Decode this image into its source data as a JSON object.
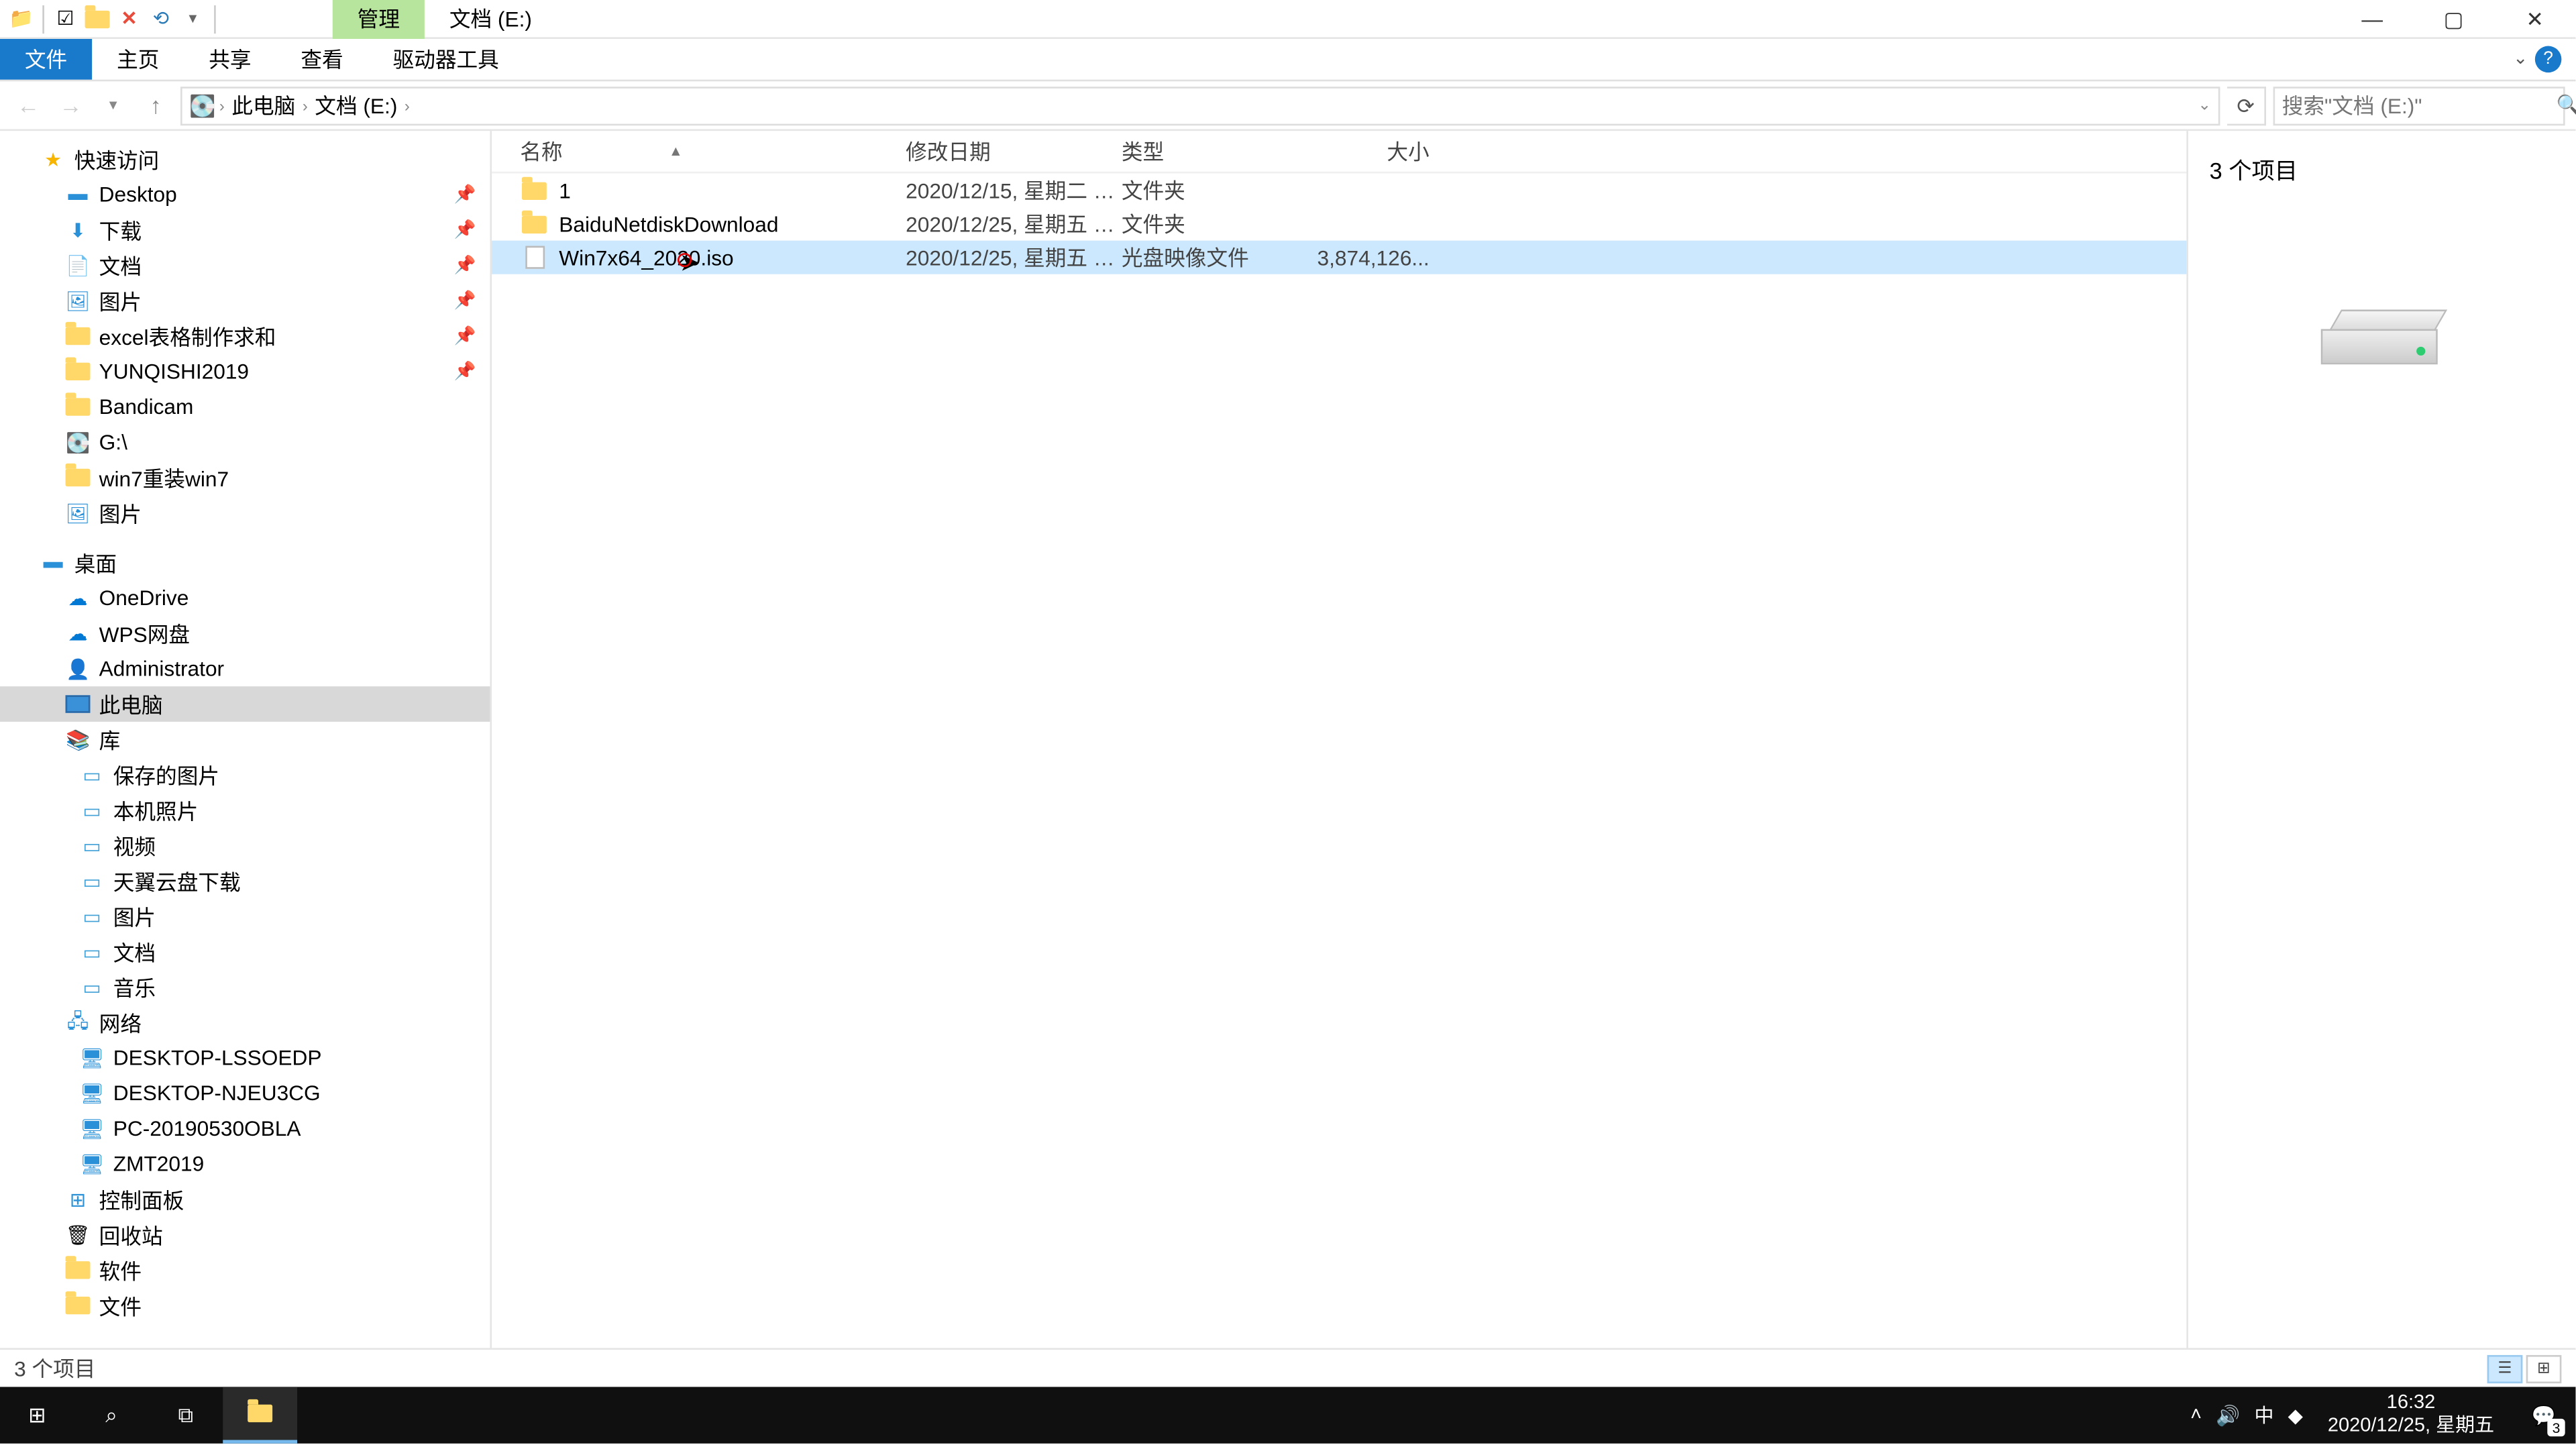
{
  "titlebar": {
    "manage_tab": "管理",
    "location_tab": "文档 (E:)"
  },
  "ribbon": {
    "file": "文件",
    "home": "主页",
    "share": "共享",
    "view": "查看",
    "drive_tools": "驱动器工具"
  },
  "address": {
    "segments": [
      "此电脑",
      "文档 (E:)"
    ],
    "search_placeholder": "搜索\"文档 (E:)\""
  },
  "columns": {
    "name": "名称",
    "date": "修改日期",
    "type": "类型",
    "size": "大小"
  },
  "files": [
    {
      "name": "1",
      "date": "2020/12/15, 星期二 1...",
      "type": "文件夹",
      "size": "",
      "icon": "folder",
      "selected": false
    },
    {
      "name": "BaiduNetdiskDownload",
      "date": "2020/12/25, 星期五 1...",
      "type": "文件夹",
      "size": "",
      "icon": "folder",
      "selected": false
    },
    {
      "name": "Win7x64_2020.iso",
      "date": "2020/12/25, 星期五 1...",
      "type": "光盘映像文件",
      "size": "3,874,126...",
      "icon": "file",
      "selected": true
    }
  ],
  "nav": {
    "quick_access": "快速访问",
    "quick_items": [
      {
        "label": "Desktop",
        "icon": "desktop",
        "pin": true
      },
      {
        "label": "下载",
        "icon": "download",
        "pin": true
      },
      {
        "label": "文档",
        "icon": "doc",
        "pin": true
      },
      {
        "label": "图片",
        "icon": "pic",
        "pin": true
      },
      {
        "label": "excel表格制作求和",
        "icon": "folder",
        "pin": true
      },
      {
        "label": "YUNQISHI2019",
        "icon": "folder",
        "pin": true
      },
      {
        "label": "Bandicam",
        "icon": "folder",
        "pin": false
      },
      {
        "label": "G:\\",
        "icon": "drive",
        "pin": false
      },
      {
        "label": "win7重装win7",
        "icon": "folder",
        "pin": false
      },
      {
        "label": "图片",
        "icon": "pic",
        "pin": false
      }
    ],
    "desktop": "桌面",
    "desktop_items": [
      {
        "label": "OneDrive",
        "icon": "cloud"
      },
      {
        "label": "WPS网盘",
        "icon": "cloud"
      },
      {
        "label": "Administrator",
        "icon": "user"
      },
      {
        "label": "此电脑",
        "icon": "pc",
        "selected": true
      },
      {
        "label": "库",
        "icon": "lib"
      }
    ],
    "lib_items": [
      {
        "label": "保存的图片"
      },
      {
        "label": "本机照片"
      },
      {
        "label": "视频"
      },
      {
        "label": "天翼云盘下载"
      },
      {
        "label": "图片"
      },
      {
        "label": "文档"
      },
      {
        "label": "音乐"
      }
    ],
    "network": "网络",
    "net_items": [
      {
        "label": "DESKTOP-LSSOEDP"
      },
      {
        "label": "DESKTOP-NJEU3CG"
      },
      {
        "label": "PC-20190530OBLA"
      },
      {
        "label": "ZMT2019"
      }
    ],
    "control_panel": "控制面板",
    "recycle": "回收站",
    "software": "软件",
    "docs": "文件"
  },
  "preview": {
    "title": "3 个项目"
  },
  "status": {
    "text": "3 个项目"
  },
  "tray": {
    "ime": "中",
    "time": "16:32",
    "date": "2020/12/25, 星期五",
    "notif_count": "3"
  }
}
